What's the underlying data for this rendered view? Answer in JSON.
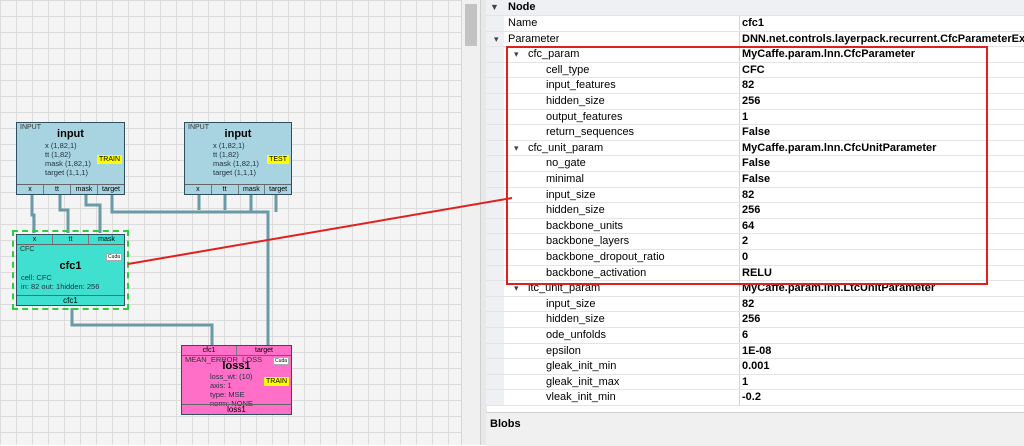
{
  "diagram": {
    "input_train": {
      "header": "INPUT",
      "title": "input",
      "lines": [
        "x (1,82,1)",
        "tt (1,82)",
        "mask (1,82,1)",
        "target (1,1,1)"
      ],
      "badge": "TRAIN",
      "ports": [
        "x",
        "tt",
        "mask",
        "target"
      ]
    },
    "input_test": {
      "header": "INPUT",
      "title": "input",
      "lines": [
        "x (1,82,1)",
        "tt (1,82)",
        "mask (1,82,1)",
        "target (1,1,1)"
      ],
      "badge": "TEST",
      "ports": [
        "x",
        "tt",
        "mask",
        "target"
      ]
    },
    "cfc_node": {
      "ports": [
        "x",
        "tt",
        "mask"
      ],
      "header": "CFC",
      "title": "cfc1",
      "lines": [
        "cell: CFC",
        "in: 82 out: 1hidden: 256"
      ],
      "footer": "cfc1",
      "mark": "Cuda"
    },
    "loss_node": {
      "ports": [
        "cfc1",
        "target"
      ],
      "header": "MEAN_ERROR_LOSS",
      "title": "loss1",
      "lines": [
        "loss_wt: (10)",
        "axis: 1",
        "type: MSE",
        "norm: NONE"
      ],
      "badge": "TRAIN",
      "footer": "loss1",
      "mark": "Cuda"
    }
  },
  "properties": {
    "category": "Node",
    "rows": [
      {
        "name": "Name",
        "value": "cfc1",
        "indent": 0,
        "expand": ""
      },
      {
        "name": "Parameter",
        "value": "DNN.net.controls.layerpack.recurrent.CfcParameterEx",
        "indent": 0,
        "expand": "v"
      },
      {
        "name": "cfc_param",
        "value": "MyCaffe.param.lnn.CfcParameter",
        "indent": 1,
        "expand": "v"
      },
      {
        "name": "cell_type",
        "value": "CFC",
        "indent": 2,
        "expand": ""
      },
      {
        "name": "input_features",
        "value": "82",
        "indent": 2,
        "expand": ""
      },
      {
        "name": "hidden_size",
        "value": "256",
        "indent": 2,
        "expand": ""
      },
      {
        "name": "output_features",
        "value": "1",
        "indent": 2,
        "expand": ""
      },
      {
        "name": "return_sequences",
        "value": "False",
        "indent": 2,
        "expand": ""
      },
      {
        "name": "cfc_unit_param",
        "value": "MyCaffe.param.lnn.CfcUnitParameter",
        "indent": 1,
        "expand": "v"
      },
      {
        "name": "no_gate",
        "value": "False",
        "indent": 2,
        "expand": ""
      },
      {
        "name": "minimal",
        "value": "False",
        "indent": 2,
        "expand": ""
      },
      {
        "name": "input_size",
        "value": "82",
        "indent": 2,
        "expand": ""
      },
      {
        "name": "hidden_size",
        "value": "256",
        "indent": 2,
        "expand": ""
      },
      {
        "name": "backbone_units",
        "value": "64",
        "indent": 2,
        "expand": ""
      },
      {
        "name": "backbone_layers",
        "value": "2",
        "indent": 2,
        "expand": ""
      },
      {
        "name": "backbone_dropout_ratio",
        "value": "0",
        "indent": 2,
        "expand": ""
      },
      {
        "name": "backbone_activation",
        "value": "RELU",
        "indent": 2,
        "expand": ""
      },
      {
        "name": "ltc_unit_param",
        "value": "MyCaffe.param.lnn.LtcUnitParameter",
        "indent": 1,
        "expand": "v"
      },
      {
        "name": "input_size",
        "value": "82",
        "indent": 2,
        "expand": ""
      },
      {
        "name": "hidden_size",
        "value": "256",
        "indent": 2,
        "expand": ""
      },
      {
        "name": "ode_unfolds",
        "value": "6",
        "indent": 2,
        "expand": ""
      },
      {
        "name": "epsilon",
        "value": "1E-08",
        "indent": 2,
        "expand": ""
      },
      {
        "name": "gleak_init_min",
        "value": "0.001",
        "indent": 2,
        "expand": ""
      },
      {
        "name": "gleak_init_max",
        "value": "1",
        "indent": 2,
        "expand": ""
      },
      {
        "name": "vleak_init_min",
        "value": "-0.2",
        "indent": 2,
        "expand": ""
      }
    ]
  },
  "blobs": {
    "label": "Blobs"
  },
  "colors": {
    "highlight": "#e02020",
    "input_node": "#a8d3e0",
    "cfc_node": "#40e0d0",
    "loss_node": "#ff6ec7",
    "badge": "#ffff00"
  },
  "icons": {
    "expander": "chevron-down-icon"
  }
}
